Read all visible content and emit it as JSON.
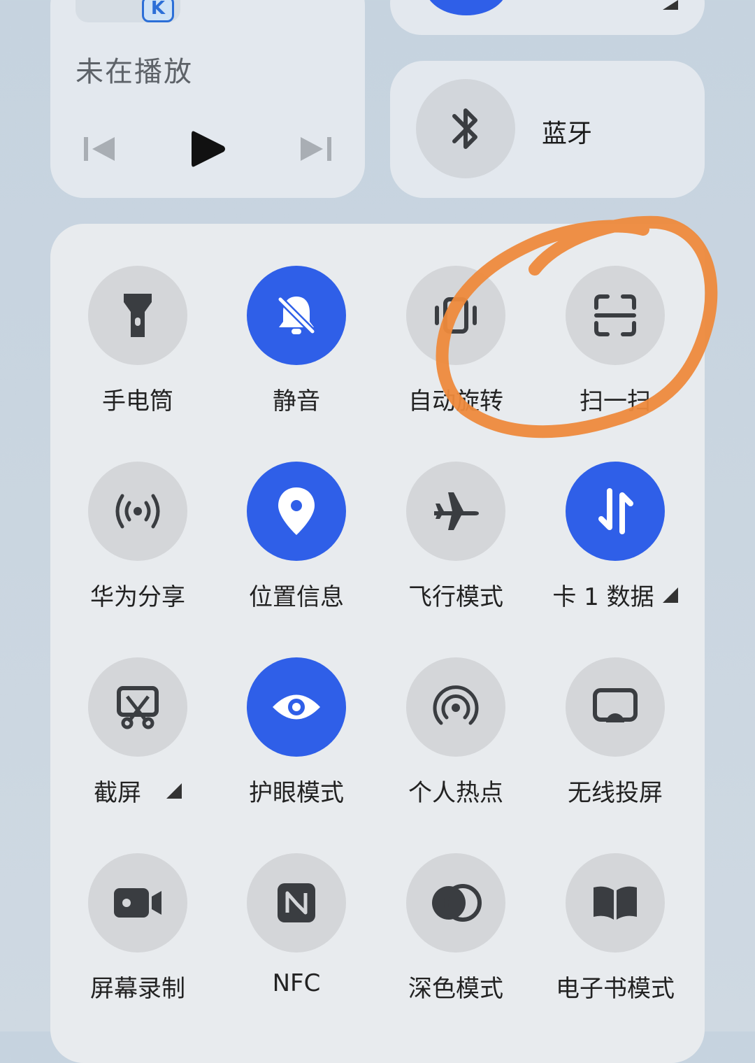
{
  "media": {
    "title": "未在播放",
    "prev_icon": "skip-previous-icon",
    "play_icon": "play-icon",
    "next_icon": "skip-next-icon"
  },
  "bluetooth": {
    "label": "蓝牙"
  },
  "tiles": [
    {
      "label": "手电筒",
      "icon": "flashlight-icon",
      "active": false
    },
    {
      "label": "静音",
      "icon": "bell-off-icon",
      "active": true
    },
    {
      "label": "自动旋转",
      "icon": "rotate-icon",
      "active": false
    },
    {
      "label": "扫一扫",
      "icon": "scan-icon",
      "active": false
    },
    {
      "label": "华为分享",
      "icon": "share-signal-icon",
      "active": false
    },
    {
      "label": "位置信息",
      "icon": "location-pin-icon",
      "active": true
    },
    {
      "label": "飞行模式",
      "icon": "airplane-icon",
      "active": false
    },
    {
      "label": "卡 1 数据",
      "icon": "data-arrows-icon",
      "active": true
    },
    {
      "label": "截屏",
      "icon": "screenshot-icon",
      "active": false
    },
    {
      "label": "护眼模式",
      "icon": "eye-icon",
      "active": true
    },
    {
      "label": "个人热点",
      "icon": "hotspot-icon",
      "active": false
    },
    {
      "label": "无线投屏",
      "icon": "cast-icon",
      "active": false
    },
    {
      "label": "屏幕录制",
      "icon": "video-camera-icon",
      "active": false
    },
    {
      "label": "NFC",
      "icon": "nfc-icon",
      "active": false
    },
    {
      "label": "深色模式",
      "icon": "dark-mode-icon",
      "active": false
    },
    {
      "label": "电子书模式",
      "icon": "book-icon",
      "active": false
    }
  ],
  "colors": {
    "active": "#2f5fe8",
    "inactive": "#d4d6d9",
    "annotation": "#ee8a3c"
  }
}
